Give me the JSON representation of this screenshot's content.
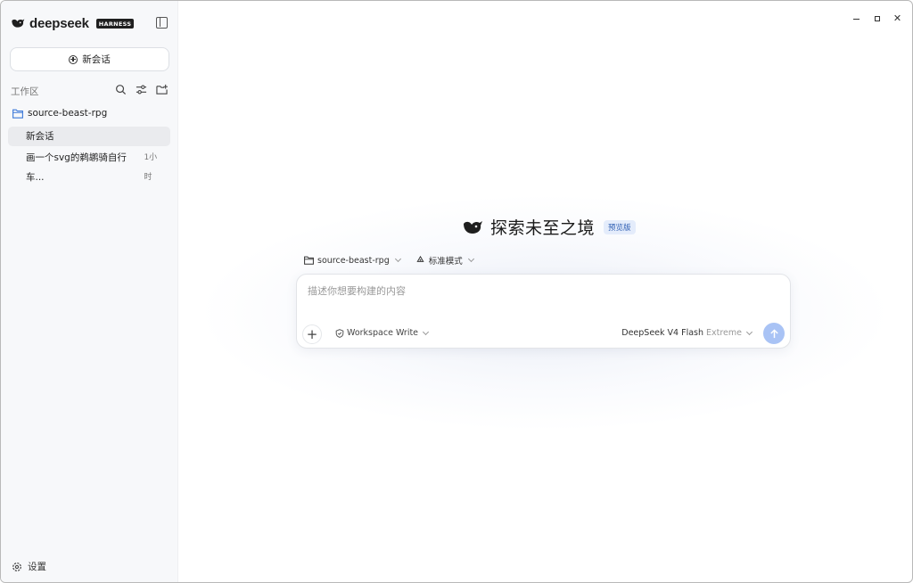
{
  "app": {
    "brand_name": "deepseek",
    "brand_badge": "HARNESS",
    "accent_color": "#a9c3f5",
    "badge_color": "#2f5fb3"
  },
  "sidebar": {
    "new_chat_label": "新会话",
    "workspace_label": "工作区",
    "tools": [
      "search-icon",
      "filter-icon",
      "new-folder-icon"
    ],
    "project_name": "source-beast-rpg",
    "conversations": [
      {
        "title": "新会话",
        "time": "",
        "active": true
      },
      {
        "title": "画一个svg的鹈鹕骑自行车...",
        "time": "1小时",
        "active": false
      }
    ],
    "settings_label": "设置"
  },
  "main": {
    "hero_title": "探索未至之境",
    "hero_badge": "预览版",
    "context_project": "source-beast-rpg",
    "context_mode": "标准模式",
    "composer": {
      "placeholder": "描述你想要构建的内容",
      "value": "",
      "permission": "Workspace Write",
      "model_name": "DeepSeek V4 Flash",
      "model_mode": "Extreme"
    }
  }
}
